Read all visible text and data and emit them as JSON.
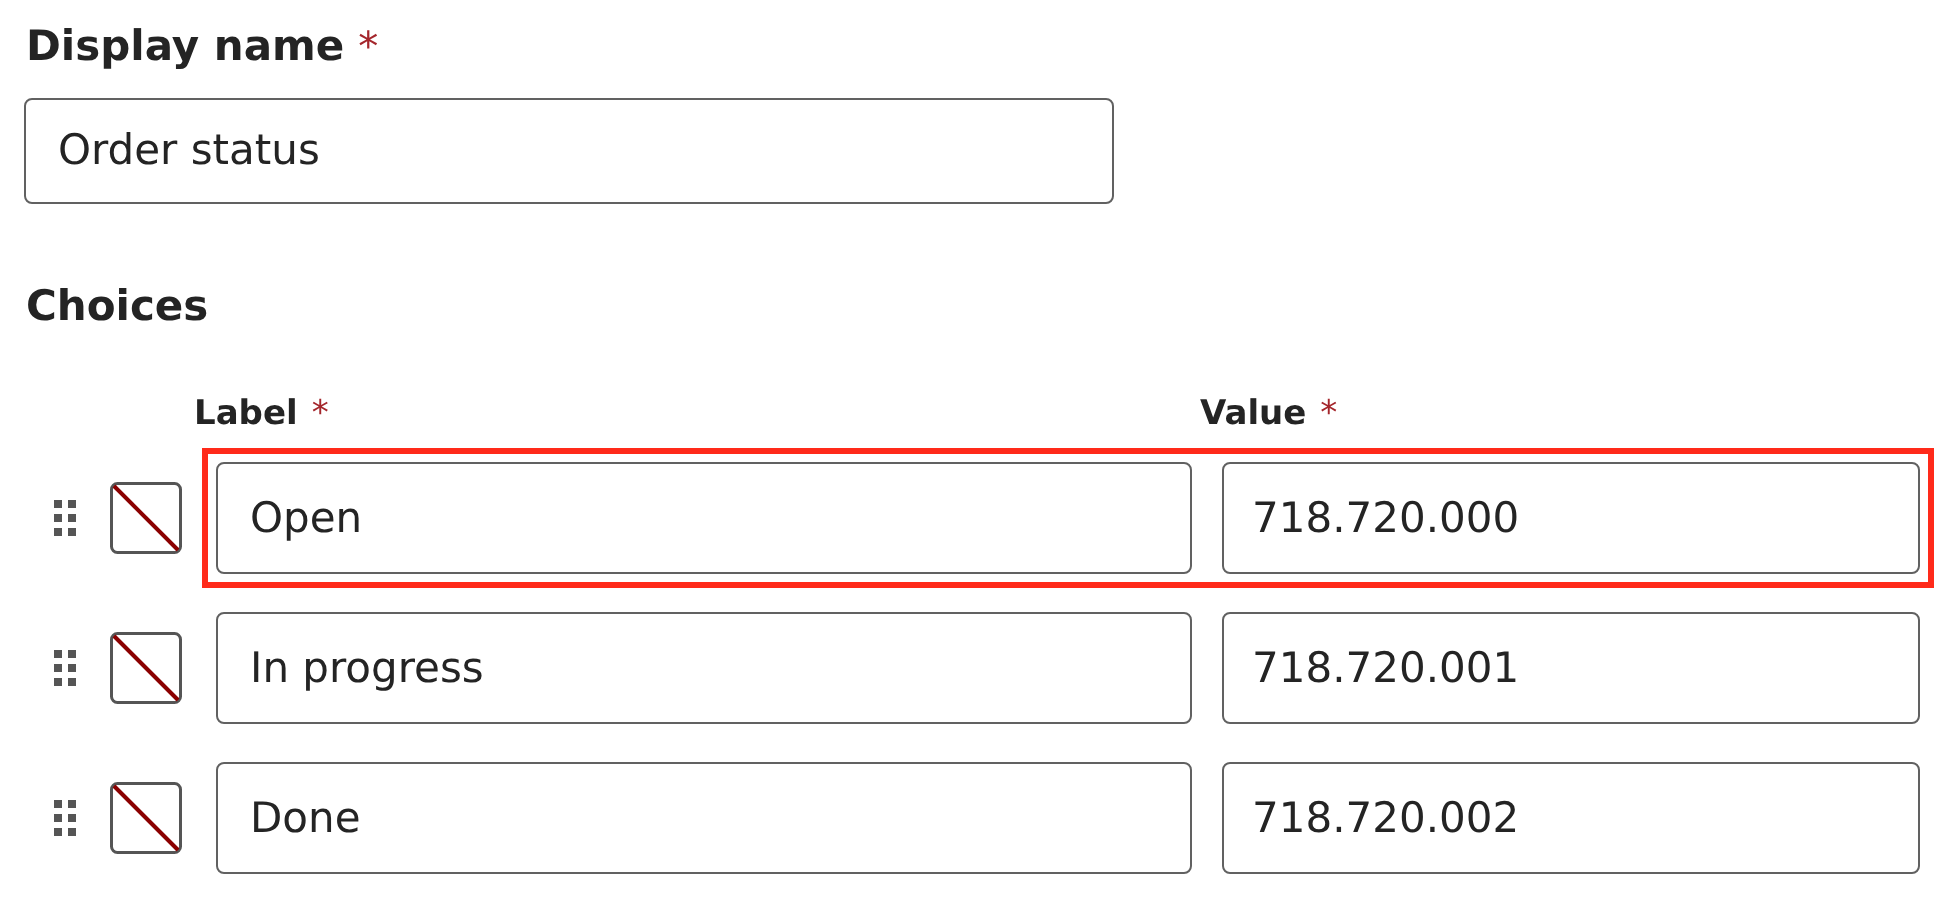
{
  "display_name": {
    "label": "Display name",
    "required_mark": "*",
    "value": "Order status"
  },
  "choices": {
    "title": "Choices",
    "columns": [
      {
        "label": "Label",
        "required_mark": "*"
      },
      {
        "label": "Value",
        "required_mark": "*"
      }
    ],
    "rows": [
      {
        "label": "Open",
        "value": "718.720.000",
        "highlighted": true
      },
      {
        "label": "In progress",
        "value": "718.720.001",
        "highlighted": false
      },
      {
        "label": "Done",
        "value": "718.720.002",
        "highlighted": false
      }
    ]
  }
}
